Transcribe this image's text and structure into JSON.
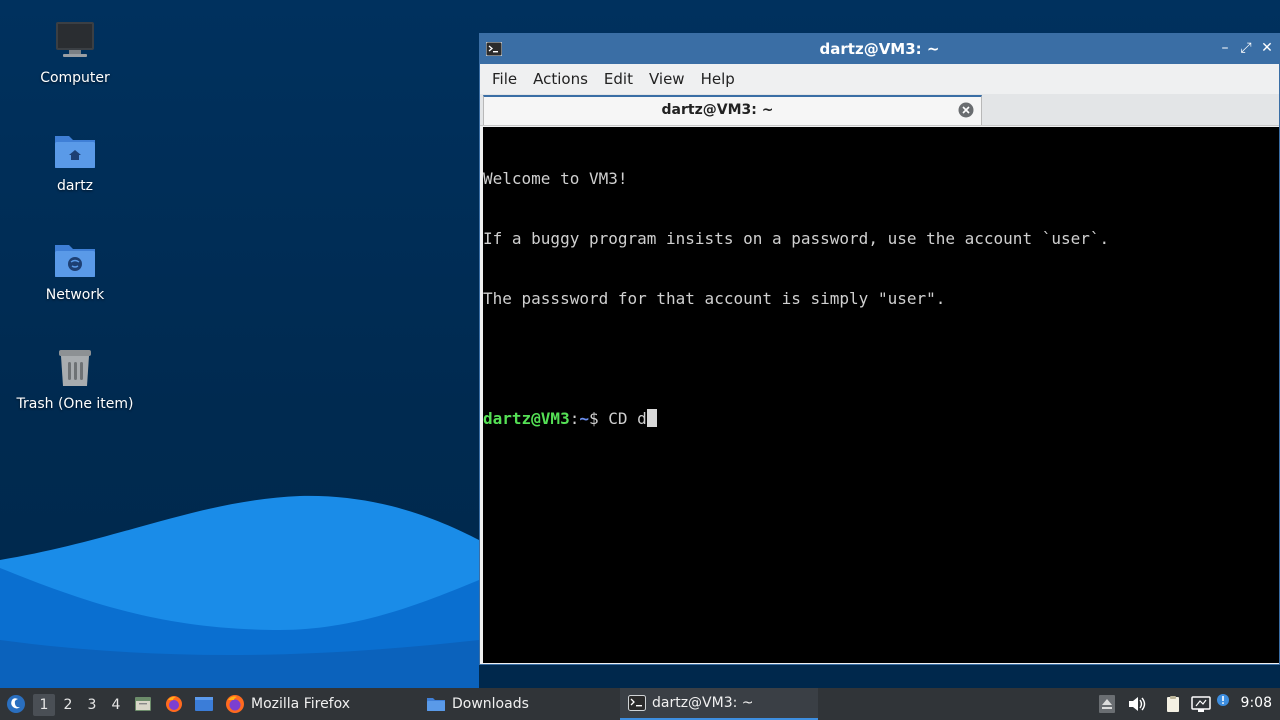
{
  "desktop": {
    "icons": [
      {
        "label": "Computer",
        "icon": "monitor-icon"
      },
      {
        "label": "dartz",
        "icon": "home-folder-icon"
      },
      {
        "label": "Network",
        "icon": "network-folder-icon"
      },
      {
        "label": "Trash (One item)",
        "icon": "trash-icon"
      }
    ]
  },
  "window": {
    "title": "dartz@VM3: ~",
    "controls": {
      "minimize": "–",
      "maximize": "⤢",
      "close": "✕"
    },
    "menu": [
      "File",
      "Actions",
      "Edit",
      "View",
      "Help"
    ],
    "tab": {
      "label": "dartz@VM3: ~"
    },
    "terminal": {
      "lines": [
        "Welcome to VM3!",
        "If a buggy program insists on a password, use the account `user`.",
        "The passsword for that account is simply \"user\".",
        ""
      ],
      "prompt_user": "dartz@VM3",
      "prompt_sep": ":",
      "prompt_path": "~",
      "prompt_symbol": "$ ",
      "command": "CD d"
    }
  },
  "taskbar": {
    "workspaces": [
      "1",
      "2",
      "3",
      "4"
    ],
    "active_workspace": "1",
    "tasks": [
      {
        "label": "Mozilla Firefox",
        "icon": "firefox-icon"
      },
      {
        "label": "Downloads",
        "icon": "folder-icon"
      },
      {
        "label": "dartz@VM3: ~",
        "icon": "terminal-icon",
        "active": true
      }
    ],
    "clock": "9:08"
  },
  "colors": {
    "desktop_bg": "#00315e",
    "window_accent": "#3a6ea5",
    "terminal_bg": "#000000",
    "prompt_user": "#55e055",
    "prompt_path": "#6b8ff0",
    "taskbar_bg": "#303438"
  }
}
